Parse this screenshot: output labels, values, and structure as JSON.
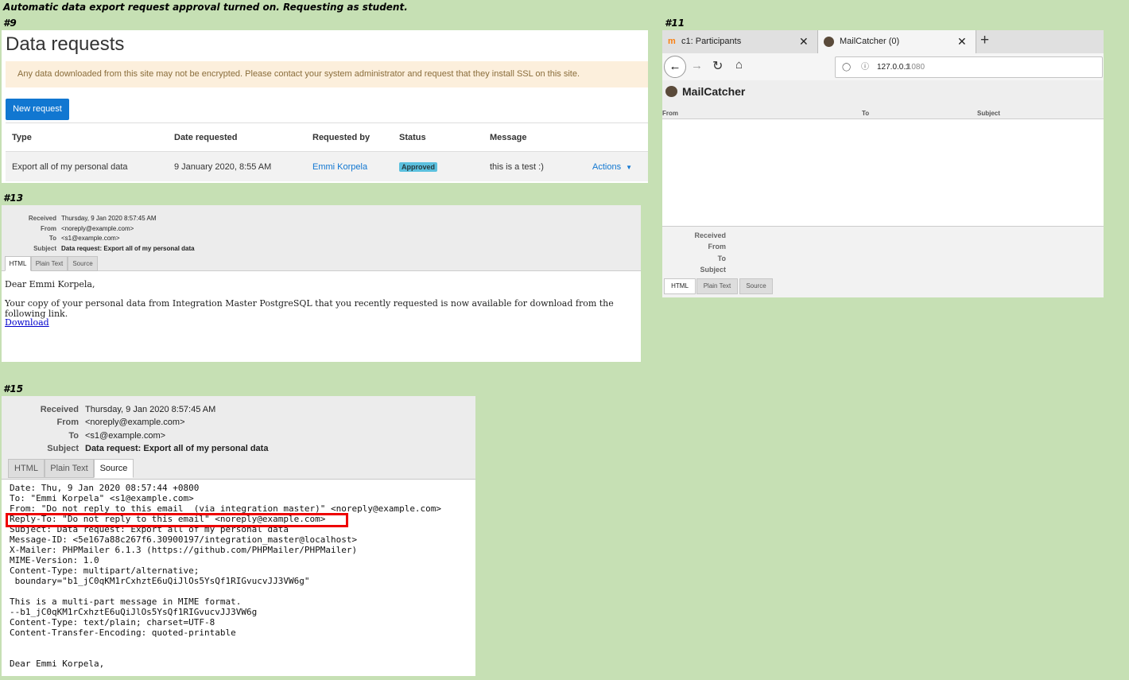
{
  "caption": "Automatic data export request approval turned on. Requesting as student.",
  "labels": {
    "p9": "#9",
    "p11": "#11",
    "p13": "#13",
    "p15": "#15"
  },
  "data_requests": {
    "title": "Data requests",
    "alert": "Any data downloaded from this site may not be encrypted. Please contact your system administrator and request that they install SSL on this site.",
    "new_request": "New request",
    "headers": {
      "type": "Type",
      "date": "Date requested",
      "requested_by": "Requested by",
      "status": "Status",
      "message": "Message"
    },
    "row": {
      "type": "Export all of my personal data",
      "date": "9 January 2020, 8:55 AM",
      "requested_by": "Emmi Korpela",
      "status": "Approved",
      "message": "this is a test :)",
      "actions": "Actions"
    },
    "colors": {
      "primary": "#1177d1",
      "alert_bg": "#fcefdc",
      "badge": "#5bc0de"
    }
  },
  "email_html": {
    "received_label": "Received",
    "received": "Thursday, 9 Jan 2020 8:57:45 AM",
    "from_label": "From",
    "from": "<noreply@example.com>",
    "to_label": "To",
    "to": "<s1@example.com>",
    "subject_label": "Subject",
    "subject": "Data request: Export all of my personal data",
    "tabs": [
      "HTML",
      "Plain Text",
      "Source"
    ],
    "greeting": "Dear Emmi Korpela,",
    "body": "Your copy of your personal data from Integration Master PostgreSQL that you recently requested is now available for download from the following link.",
    "link": "Download"
  },
  "browser": {
    "tabs": [
      {
        "label": "c1: Participants",
        "icon": "moodle-icon"
      },
      {
        "label": "MailCatcher (0)",
        "icon": "mailcatcher-icon"
      }
    ],
    "new_tab": "+",
    "url_host": "127.0.0.1",
    "url_port": ":1080",
    "app_title": "MailCatcher",
    "columns": {
      "from": "From",
      "to": "To",
      "subject": "Subject"
    },
    "meta_labels": {
      "received": "Received",
      "from": "From",
      "to": "To",
      "subject": "Subject"
    },
    "tabs_view": [
      "HTML",
      "Plain Text",
      "Source"
    ]
  },
  "email_source": {
    "received_label": "Received",
    "received": "Thursday, 9 Jan 2020 8:57:45 AM",
    "from_label": "From",
    "from": "<noreply@example.com>",
    "to_label": "To",
    "to": "<s1@example.com>",
    "subject_label": "Subject",
    "subject": "Data request: Export all of my personal data",
    "tabs": [
      "HTML",
      "Plain Text",
      "Source"
    ],
    "source": "Date: Thu, 9 Jan 2020 08:57:44 +0800\nTo: \"Emmi Korpela\" <s1@example.com>\nFrom: \"Do not reply to this email  (via integration master)\" <noreply@example.com>\nReply-To: \"Do not reply to this email\" <noreply@example.com>\nSubject: Data request: Export all of my personal data\nMessage-ID: <5e167a88c267f6.30900197/integration_master@localhost>\nX-Mailer: PHPMailer 6.1.3 (https://github.com/PHPMailer/PHPMailer)\nMIME-Version: 1.0\nContent-Type: multipart/alternative;\n boundary=\"b1_jC0qKM1rCxhztE6uQiJlOs5YsQf1RIGvucvJJ3VW6g\"\n\nThis is a multi-part message in MIME format.\n--b1_jC0qKM1rCxhztE6uQiJlOs5YsQf1RIGvucvJJ3VW6g\nContent-Type: text/plain; charset=UTF-8\nContent-Transfer-Encoding: quoted-printable\n\n\nDear Emmi Korpela,"
  }
}
